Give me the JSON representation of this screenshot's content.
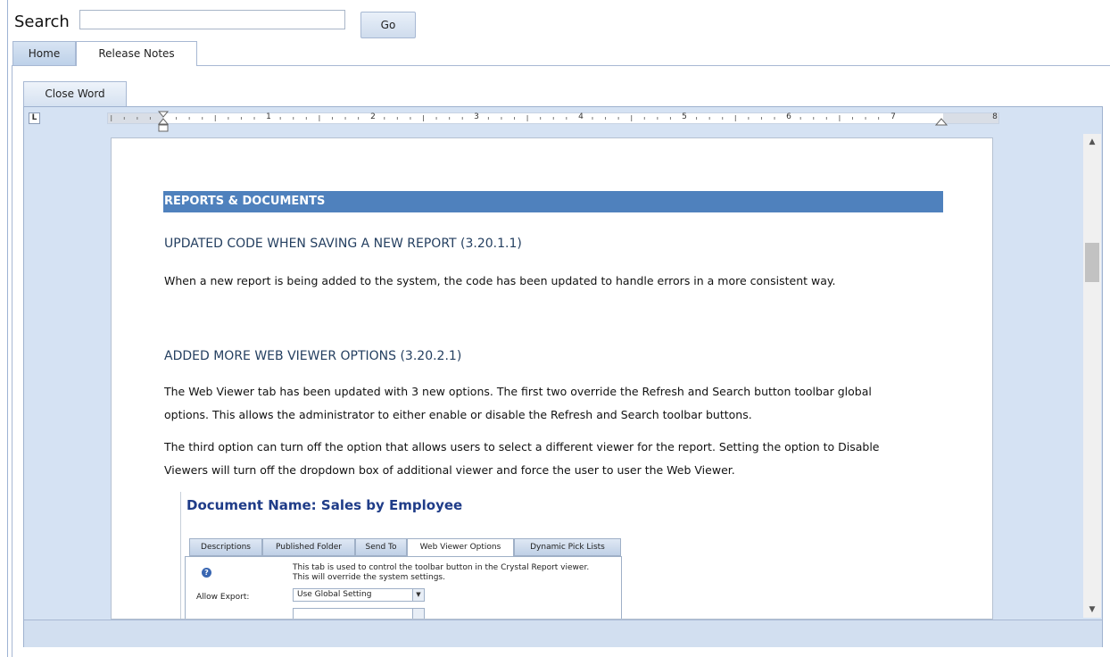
{
  "search": {
    "label": "Search",
    "value": "",
    "go_label": "Go"
  },
  "tabs": [
    {
      "label": "Home"
    },
    {
      "label": "Release Notes"
    }
  ],
  "toolbar": {
    "close_word_label": "Close Word"
  },
  "ruler": {
    "numbers": [
      "1",
      "2",
      "3",
      "4",
      "5",
      "6",
      "7",
      "8"
    ],
    "corner_glyph": "L"
  },
  "document": {
    "section_title": "REPORTS & DOCUMENTS",
    "heading1": "UPDATED CODE WHEN SAVING A NEW REPORT (3.20.1.1)",
    "para1": "When a new report is being added to the system, the code has been updated to handle errors in a more consistent way.",
    "heading2": "ADDED MORE WEB VIEWER OPTIONS (3.20.2.1)",
    "para2_line1": "The Web Viewer tab has been updated with 3 new options.  The first two override the Refresh and Search button toolbar global",
    "para2_line2": "options.  This allows the administrator to either enable or disable the Refresh and Search toolbar buttons.",
    "para3_line1": "The third option can turn off the option that allows users to select a different viewer for the report.  Setting the option to Disable",
    "para3_line2": "Viewers will turn off the dropdown box of additional viewer and force the user to user the Web Viewer."
  },
  "embedded": {
    "doc_name": "Document Name: Sales by Employee",
    "tabs": [
      "Descriptions",
      "Published Folder",
      "Send To",
      "Web Viewer Options",
      "Dynamic Pick Lists"
    ],
    "desc_line1": "This tab is used to control the toolbar button in the Crystal Report viewer.",
    "desc_line2": "This will override the system settings.",
    "allow_export_label": "Allow Export:",
    "allow_export_value": "Use Global Setting"
  },
  "colors": {
    "section_bar": "#4f81bd",
    "heading": "#243f60",
    "frame_bg": "#d5e2f3",
    "doc_name": "#1f3c88"
  },
  "icons": {
    "help": "question-icon",
    "scroll_up": "triangle-up",
    "scroll_down": "triangle-down"
  }
}
